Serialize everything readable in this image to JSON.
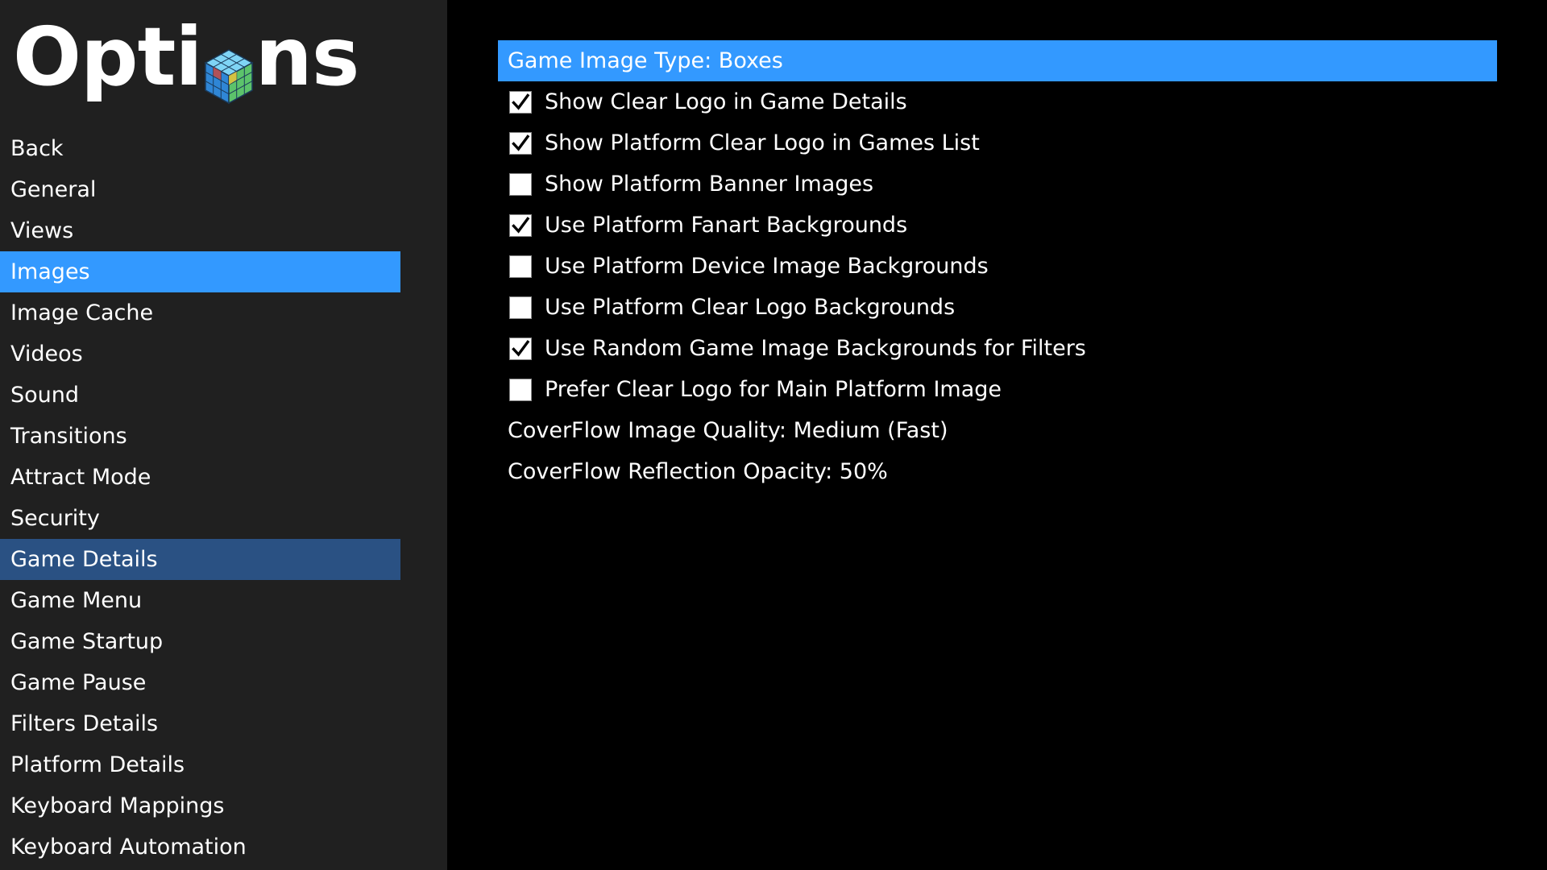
{
  "sidebar": {
    "title_start": "Opti",
    "title_end": "ns",
    "logo_icon": "launchbox-cube-icon",
    "items": [
      {
        "label": "Back",
        "state": "normal"
      },
      {
        "label": "General",
        "state": "normal"
      },
      {
        "label": "Views",
        "state": "normal"
      },
      {
        "label": "Images",
        "state": "selected"
      },
      {
        "label": "Image Cache",
        "state": "normal"
      },
      {
        "label": "Videos",
        "state": "normal"
      },
      {
        "label": "Sound",
        "state": "normal"
      },
      {
        "label": "Transitions",
        "state": "normal"
      },
      {
        "label": "Attract Mode",
        "state": "normal"
      },
      {
        "label": "Security",
        "state": "normal"
      },
      {
        "label": "Game Details",
        "state": "highlighted"
      },
      {
        "label": "Game Menu",
        "state": "normal"
      },
      {
        "label": "Game Startup",
        "state": "normal"
      },
      {
        "label": "Game Pause",
        "state": "normal"
      },
      {
        "label": "Filters Details",
        "state": "normal"
      },
      {
        "label": "Platform Details",
        "state": "normal"
      },
      {
        "label": "Keyboard Mappings",
        "state": "normal"
      },
      {
        "label": "Keyboard Automation",
        "state": "normal"
      }
    ]
  },
  "content": {
    "game_image_type": "Game Image Type: Boxes",
    "options": [
      {
        "label": "Show Clear Logo in Game Details",
        "checked": true
      },
      {
        "label": "Show Platform Clear Logo in Games List",
        "checked": true
      },
      {
        "label": "Show Platform Banner Images",
        "checked": false
      },
      {
        "label": "Use Platform Fanart Backgrounds",
        "checked": true
      },
      {
        "label": "Use Platform Device Image Backgrounds",
        "checked": false
      },
      {
        "label": "Use Platform Clear Logo Backgrounds",
        "checked": false
      },
      {
        "label": "Use Random Game Image Backgrounds for Filters",
        "checked": true
      },
      {
        "label": "Prefer Clear Logo for Main Platform Image",
        "checked": false
      }
    ],
    "coverflow_quality": "CoverFlow Image Quality: Medium (Fast)",
    "coverflow_opacity": "CoverFlow Reflection Opacity: 50%"
  },
  "colors": {
    "background": "#000000",
    "sidebar_background": "#202020",
    "selected": "#3399ff",
    "highlighted": "#2a5183",
    "text": "#ffffff"
  }
}
